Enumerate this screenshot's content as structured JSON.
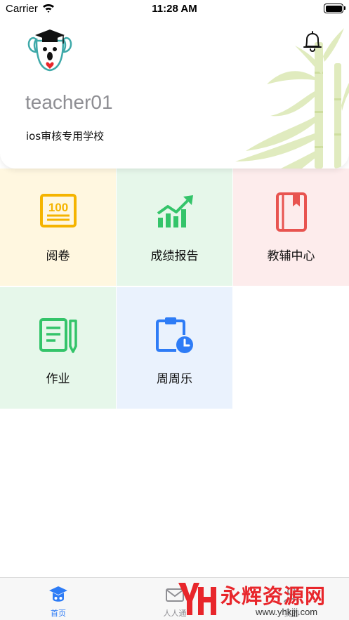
{
  "status_bar": {
    "carrier": "Carrier",
    "time": "11:28 AM"
  },
  "header": {
    "username": "teacher01",
    "school": "ios审核专用学校",
    "avatar_icon": "graduate-koala-avatar",
    "bell_icon": "bell-icon"
  },
  "grid": [
    {
      "label": "阅卷",
      "icon": "score-100-icon",
      "color": "#f5b400",
      "bg": "#fff7e0"
    },
    {
      "label": "成绩报告",
      "icon": "growth-chart-icon",
      "color": "#34c46a",
      "bg": "#e6f7ea"
    },
    {
      "label": "教辅中心",
      "icon": "book-icon",
      "color": "#e85450",
      "bg": "#fdecec"
    },
    {
      "label": "作业",
      "icon": "notebook-pen-icon",
      "color": "#34c46a",
      "bg": "#e6f7ea"
    },
    {
      "label": "周周乐",
      "icon": "clipboard-clock-icon",
      "color": "#2e7cf6",
      "bg": "#eaf2fd"
    }
  ],
  "tab_bar": {
    "items": [
      {
        "label": "首页",
        "icon": "graduate-cap-icon",
        "active": true
      },
      {
        "label": "人人通",
        "icon": "mail-icon",
        "active": false
      },
      {
        "label": "我的",
        "icon": "user-icon",
        "active": false
      }
    ]
  },
  "watermark": {
    "text": "永辉资源网",
    "url": "www.yhkjjj.com"
  },
  "colors": {
    "accent": "#2e7cf6",
    "watermark": "#e8262b"
  }
}
